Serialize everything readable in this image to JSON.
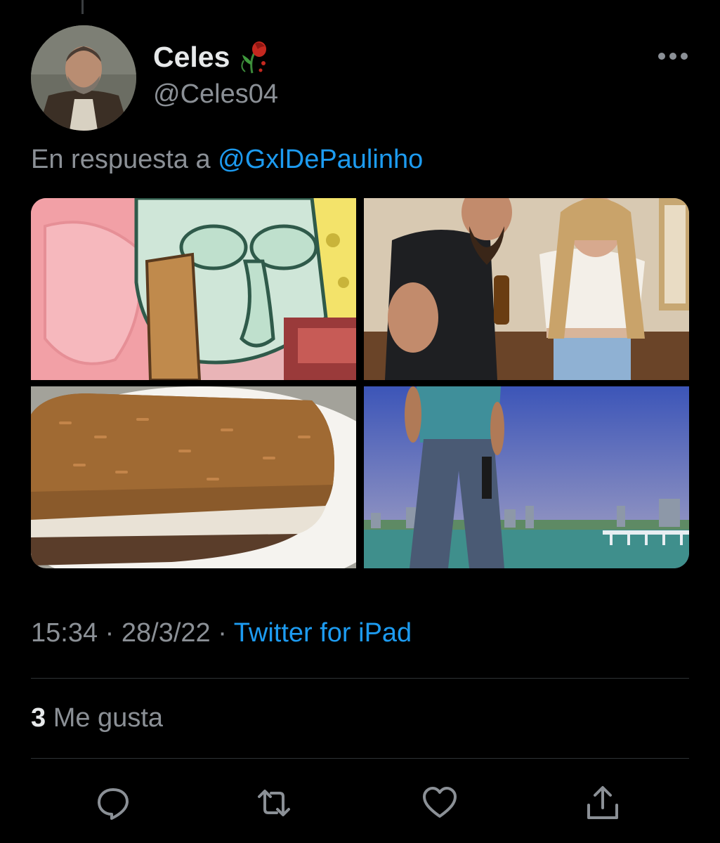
{
  "tweet": {
    "display_name": "Celes",
    "handle": "@Celes04",
    "reply_prefix": "En respuesta a",
    "reply_to": "@GxlDePaulinho",
    "time": "15:34",
    "date": "28/3/22",
    "source": "Twitter for iPad",
    "separator": "·",
    "likes_count": "3",
    "likes_label": "Me gusta"
  },
  "media": [
    {
      "description": "squidward-meme"
    },
    {
      "description": "bearded-man-with-woman"
    },
    {
      "description": "rice-dish"
    },
    {
      "description": "game-character-by-water"
    }
  ],
  "icons": {
    "more": "more-dots-icon",
    "reply": "reply-icon",
    "retweet": "retweet-icon",
    "like": "heart-icon",
    "share": "share-icon",
    "emoji": "wilted-rose-icon"
  },
  "colors": {
    "background": "#000000",
    "text_primary": "#e7e9ea",
    "text_secondary": "#8b9096",
    "accent": "#1d9bf0",
    "divider": "#2f3336"
  }
}
